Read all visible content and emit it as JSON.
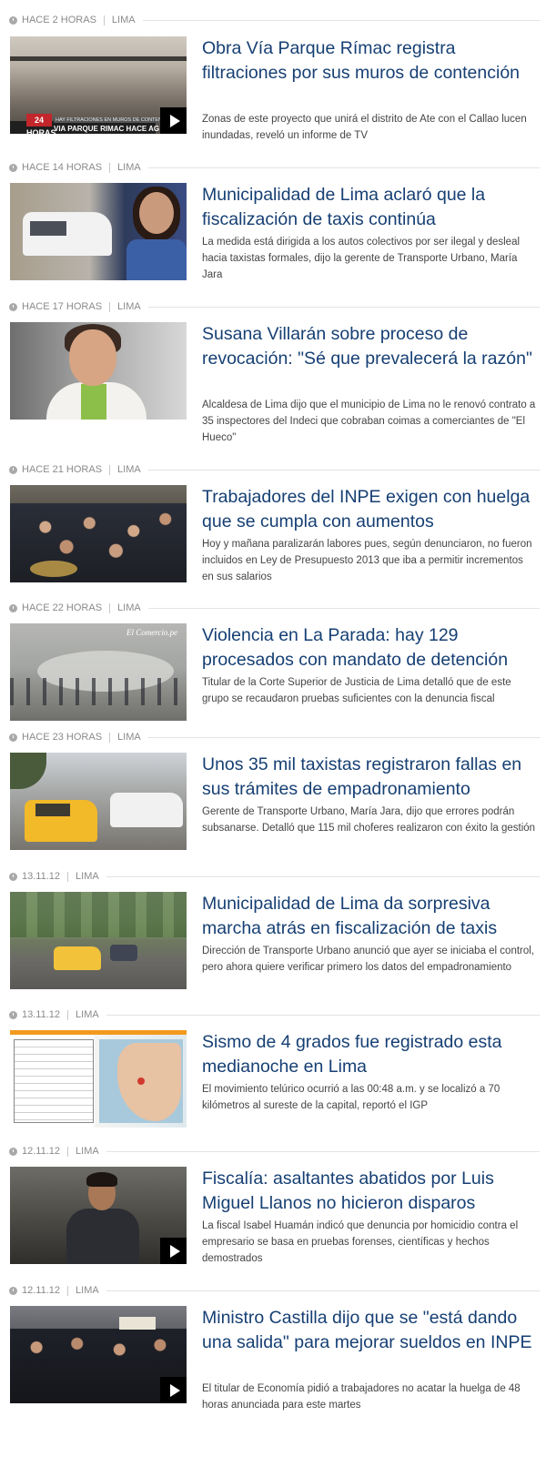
{
  "news_items": [
    {
      "time": "HACE 2 HORAS",
      "section": "LIMA",
      "title": "Obra Vía Parque Rímac registra filtraciones por sus muros de contención",
      "summary": "Zonas de este proyecto que unirá el distrito de Ate con el Callao lucen inundadas, reveló un informe de TV",
      "has_video": true,
      "thumb_text_logo": "24 HORAS",
      "thumb_text_ticker": "VIA PARQUE RIMAC HACE AG",
      "thumb_text_ticker_small": "HAY FILTRACIONES EN MUROS DE CONTENCION"
    },
    {
      "time": "HACE 14 HORAS",
      "section": "LIMA",
      "title": "Municipalidad de Lima aclaró que la fiscalización de taxis continúa",
      "summary": "La medida está dirigida a los autos colectivos por ser ilegal y desleal hacia taxistas formales, dijo la gerente de Transporte Urbano, María Jara",
      "has_video": false
    },
    {
      "time": "HACE 17 HORAS",
      "section": "LIMA",
      "title": "Susana Villarán sobre proceso de revocación: \"Sé que prevalecerá la razón\"",
      "summary": "Alcaldesa de Lima dijo que el municipio de Lima no le renovó contrato a 35 inspectores del Indeci que cobraban coimas a comerciantes de \"El Hueco\"",
      "has_video": false
    },
    {
      "time": "HACE 21 HORAS",
      "section": "LIMA",
      "title": "Trabajadores del INPE exigen con huelga que se cumpla con aumentos",
      "summary": "Hoy y mañana paralizarán labores pues, según denunciaron, no fueron incluidos en Ley de Presupuesto 2013 que iba a permitir incrementos en sus salarios",
      "has_video": false
    },
    {
      "time": "HACE 22 HORAS",
      "section": "LIMA",
      "title": "Violencia en La Parada: hay 129 procesados con mandato de detención",
      "summary": "Titular de la Corte Superior de Justicia de Lima detalló que de este grupo se recaudaron pruebas suficientes con la denuncia fiscal",
      "has_video": false,
      "thumb_text_watermark": "El Comercio.pe"
    },
    {
      "time": "HACE 23 HORAS",
      "section": "LIMA",
      "title": "Unos 35 mil taxistas registraron fallas en sus trámites de empadronamiento",
      "summary": "Gerente de Transporte Urbano, María Jara, dijo que errores podrán subsanarse. Detalló que 115 mil choferes realizaron con éxito la gestión",
      "has_video": false
    },
    {
      "time": "13.11.12",
      "section": "LIMA",
      "title": "Municipalidad de Lima da sorpresiva marcha atrás en fiscalización de taxis",
      "summary": "Dirección de Transporte Urbano anunció que ayer se iniciaba el control, pero ahora quiere verificar primero los datos del empadronamiento",
      "has_video": false
    },
    {
      "time": "13.11.12",
      "section": "LIMA",
      "title": "Sismo de 4 grados fue registrado esta medianoche en Lima",
      "summary": "El movimiento telúrico ocurrió a las 00:48 a.m. y se localizó a 70 kilómetros al sureste de la capital, reportó el IGP",
      "has_video": false
    },
    {
      "time": "12.11.12",
      "section": "LIMA",
      "title": "Fiscalía: asaltantes abatidos por Luis Miguel Llanos no hicieron disparos",
      "summary": "La fiscal Isabel Huamán indicó que denuncia por homicidio contra el empresario se basa en pruebas forenses, científicas y hechos demostrados",
      "has_video": true
    },
    {
      "time": "12.11.12",
      "section": "LIMA",
      "title": "Ministro Castilla dijo que se \"está dando una salida\" para mejorar sueldos en INPE",
      "summary": "El titular de Economía pidió a trabajadores no acatar la huelga de 48 horas anunciada para este martes",
      "has_video": true
    }
  ],
  "colors": {
    "headline": "#163f73",
    "meta": "#8a8a8a",
    "summary": "#444444"
  }
}
